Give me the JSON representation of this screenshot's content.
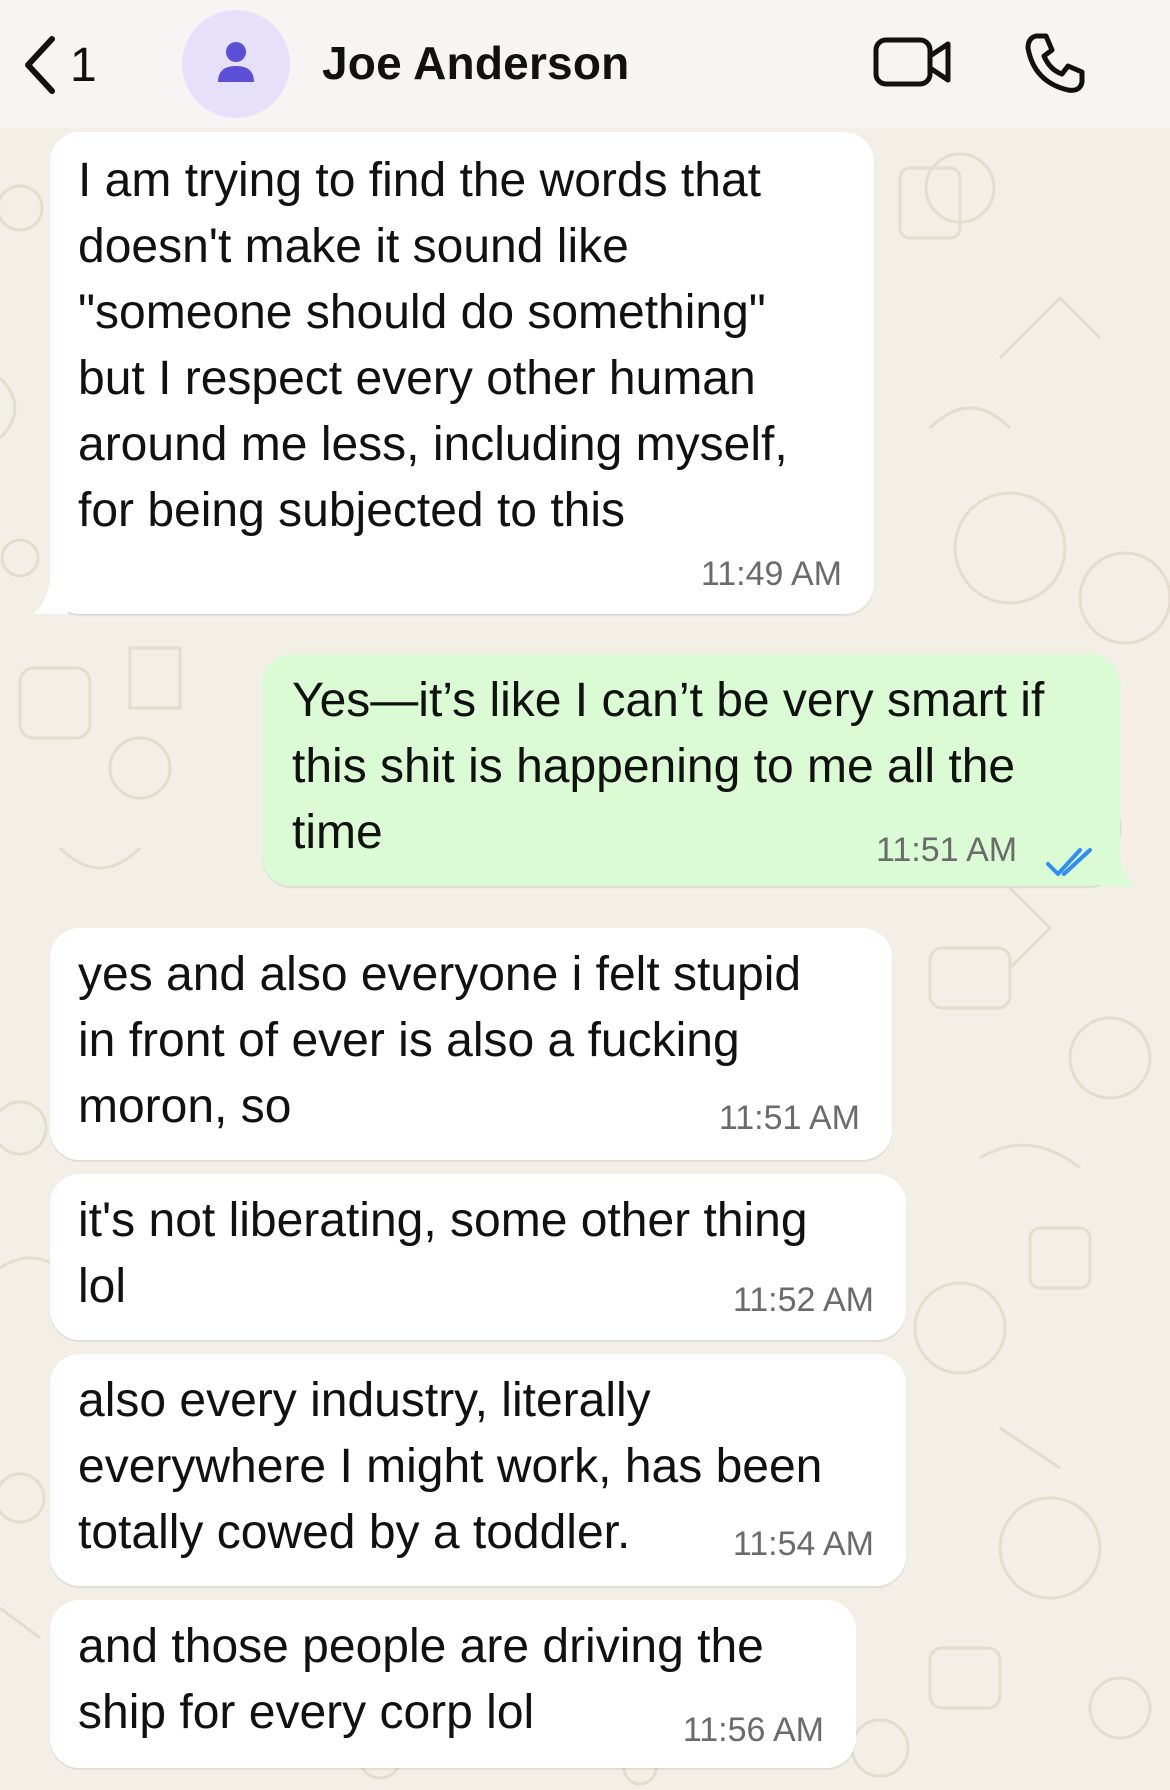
{
  "header": {
    "back_count": "1",
    "contact_name": "Joe Anderson",
    "back_icon": "chevron-left-icon",
    "avatar_icon": "person-icon",
    "video_icon": "video-camera-icon",
    "call_icon": "phone-icon",
    "accent_color": "#5b4fd6"
  },
  "messages": [
    {
      "direction": "incoming",
      "lines": [
        "I am trying to find the words that",
        "doesn't make it sound like",
        "\"someone should do something\"",
        "but I respect every other human",
        "around me less, including myself,",
        "for being subjected to this"
      ],
      "time": "11:49 AM"
    },
    {
      "direction": "outgoing",
      "lines": [
        "Yes—it’s like I can’t be very smart if",
        "this shit is happening to me all the",
        "time"
      ],
      "time": "11:51 AM",
      "status": "read",
      "status_color": "#2f8ef4"
    },
    {
      "direction": "incoming",
      "lines": [
        "yes and also everyone i felt stupid",
        "in front of ever is also a fucking",
        "moron, so"
      ],
      "time": "11:51 AM"
    },
    {
      "direction": "incoming",
      "lines": [
        "it's not liberating, some other thing",
        "lol"
      ],
      "time": "11:52 AM"
    },
    {
      "direction": "incoming",
      "lines": [
        "also every industry, literally",
        "everywhere I might work, has been",
        "totally cowed by a toddler."
      ],
      "time": "11:54 AM"
    },
    {
      "direction": "incoming",
      "lines": [
        "and those people are driving the",
        "ship for every corp lol"
      ],
      "time": "11:56 AM"
    }
  ],
  "colors": {
    "incoming_bubble": "#ffffff",
    "outgoing_bubble": "#dafbd3",
    "wallpaper": "#f3efe7",
    "header": "#f6f5f3"
  }
}
